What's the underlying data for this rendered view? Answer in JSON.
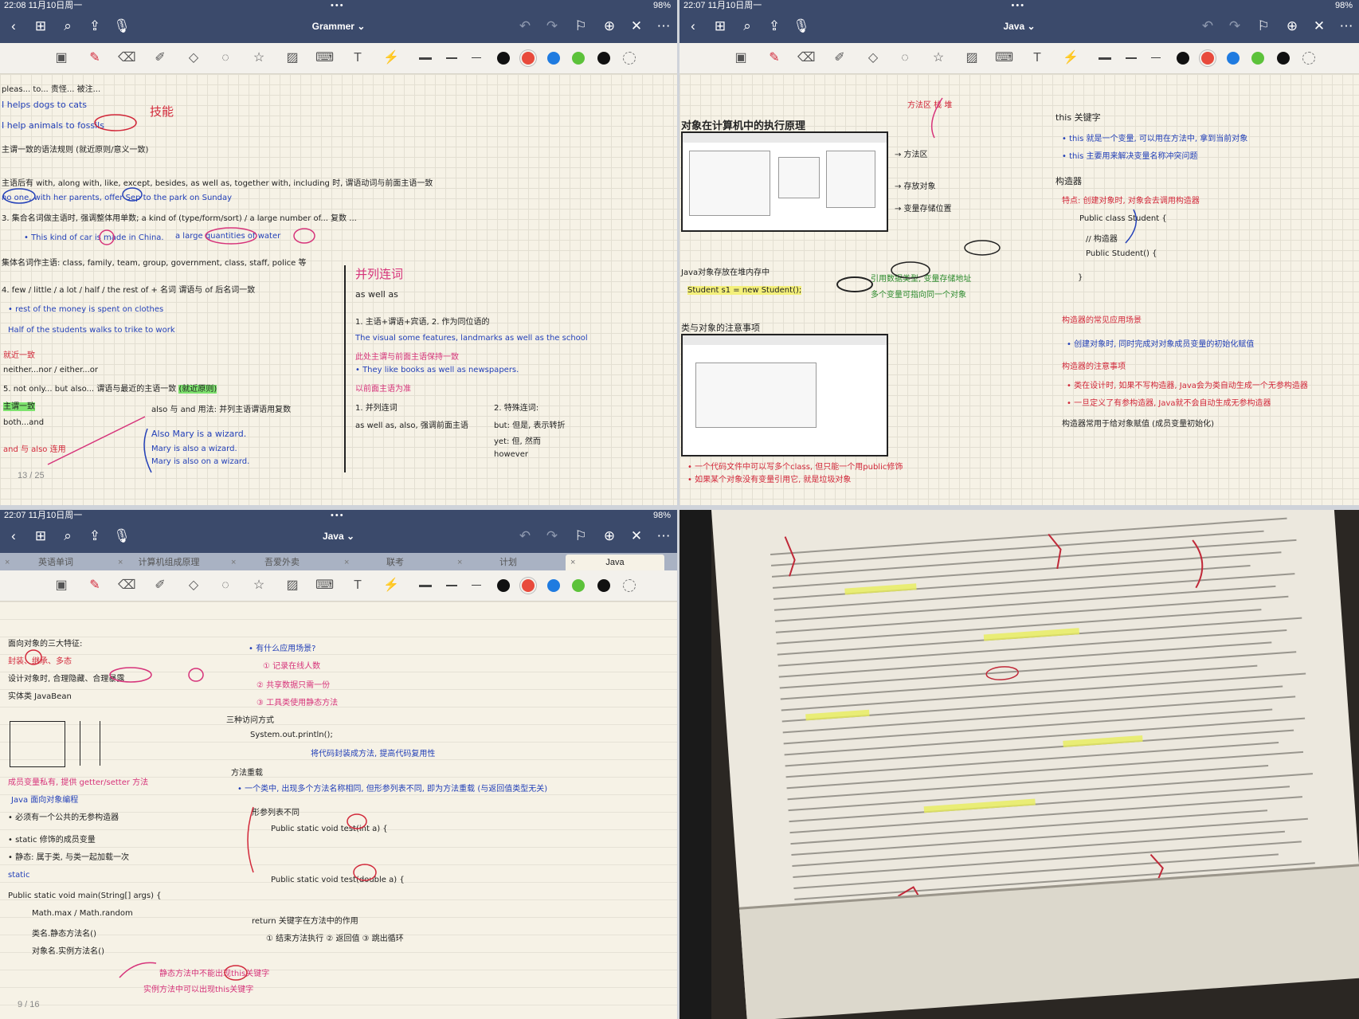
{
  "panels": {
    "p1": {
      "status": {
        "time": "22:08",
        "date": "11月10日周一",
        "dots": "•••",
        "battery": "98%"
      },
      "title": "Grammer",
      "page_indicator": "13 / 25",
      "notes": [
        "I helps dogs to cats",
        "I help animals to fossils",
        "技能",
        "a large quantities of water",
        "The visual some features, landmarks as well as the school",
        "Half of the students walks to trike to work",
        "rest of the money is spent on clothes",
        "并列连词",
        "as well as",
        "Also Mary is a wizard.",
        "neither...nor / either...or",
        "both...and",
        "主谓一致"
      ]
    },
    "p2": {
      "status": {
        "time": "22:07",
        "date": "11月10日周一",
        "dots": "•••",
        "battery": "98%"
      },
      "title": "Java",
      "notes": [
        "对象在计算机中的执行原理",
        "this 关键字",
        "构造器",
        "Public class Student {",
        "Public Student() {",
        "}",
        "Student s1 = new Student();",
        "类与对象的注意事项"
      ]
    },
    "p3": {
      "status": {
        "time": "22:07",
        "date": "11月10日周一",
        "dots": "•••",
        "battery": "98%"
      },
      "title": "Java",
      "tabs": [
        "英语单词",
        "计算机组成原理",
        "吾爱外卖",
        "联考",
        "计划",
        "Java"
      ],
      "page_indicator": "9 / 16",
      "notes": [
        "static",
        "Public static void main(String[] args) {",
        "System.out.println();",
        "Java 面向对象编程"
      ]
    }
  },
  "toolbar": {
    "colors": [
      "#111111",
      "#e84a3c",
      "#1f7be0",
      "#5cc23a",
      "#111111"
    ],
    "tools": [
      "lasso-icon",
      "pen-icon",
      "eraser-icon",
      "highlighter-icon",
      "shapes-icon",
      "lasso-select-icon",
      "sticker-icon",
      "image-icon",
      "keyboard-icon",
      "text-icon",
      "laser-icon"
    ]
  },
  "colors": {
    "nav_bg": "#3b4a6b",
    "paper": "#f6f2e6",
    "ink_blue": "#2340b8",
    "ink_red": "#d2283a",
    "highlight_green": "#7ee36e"
  }
}
